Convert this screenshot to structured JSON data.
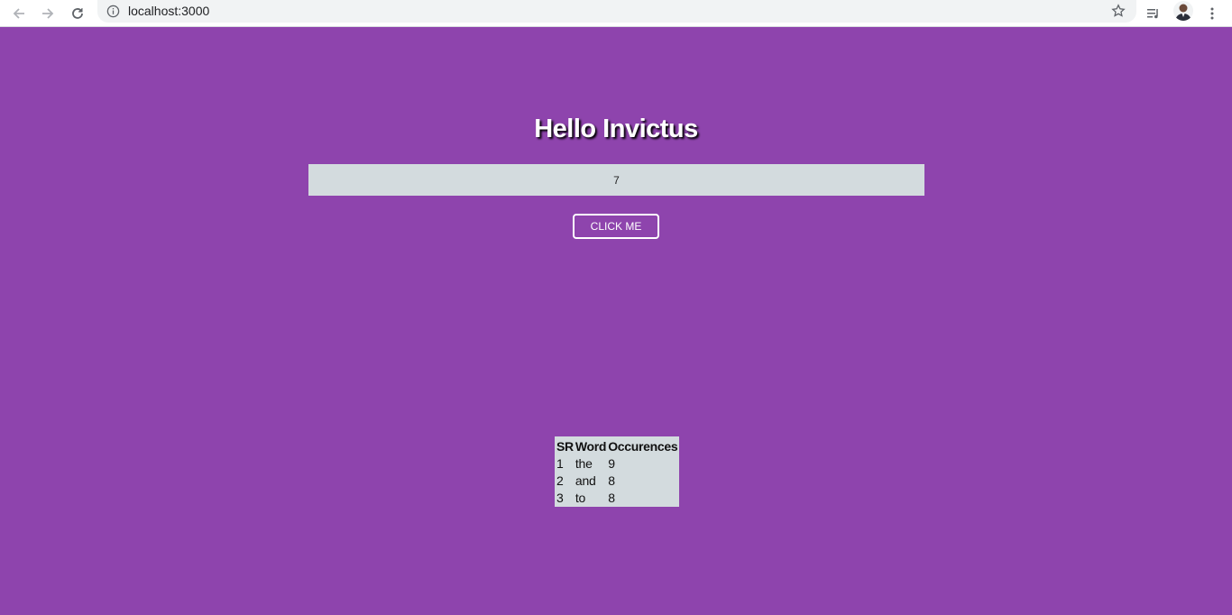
{
  "browser": {
    "url": "localhost:3000",
    "icons": {
      "back": "arrow-left-icon",
      "forward": "arrow-right-icon",
      "reload": "reload-icon",
      "info": "info-icon",
      "star": "star-icon",
      "media": "media-control-icon",
      "menu": "kebab-menu-icon"
    }
  },
  "page": {
    "title": "Hello Invictus",
    "input_value": "7",
    "button_label": "CLICK ME",
    "background_color": "#8e44ad"
  },
  "table": {
    "headers": [
      "SR",
      "Word",
      "Occurences"
    ],
    "rows": [
      [
        "1",
        "the",
        "9"
      ],
      [
        "2",
        "and",
        "8"
      ],
      [
        "3",
        "to",
        "8"
      ]
    ]
  }
}
